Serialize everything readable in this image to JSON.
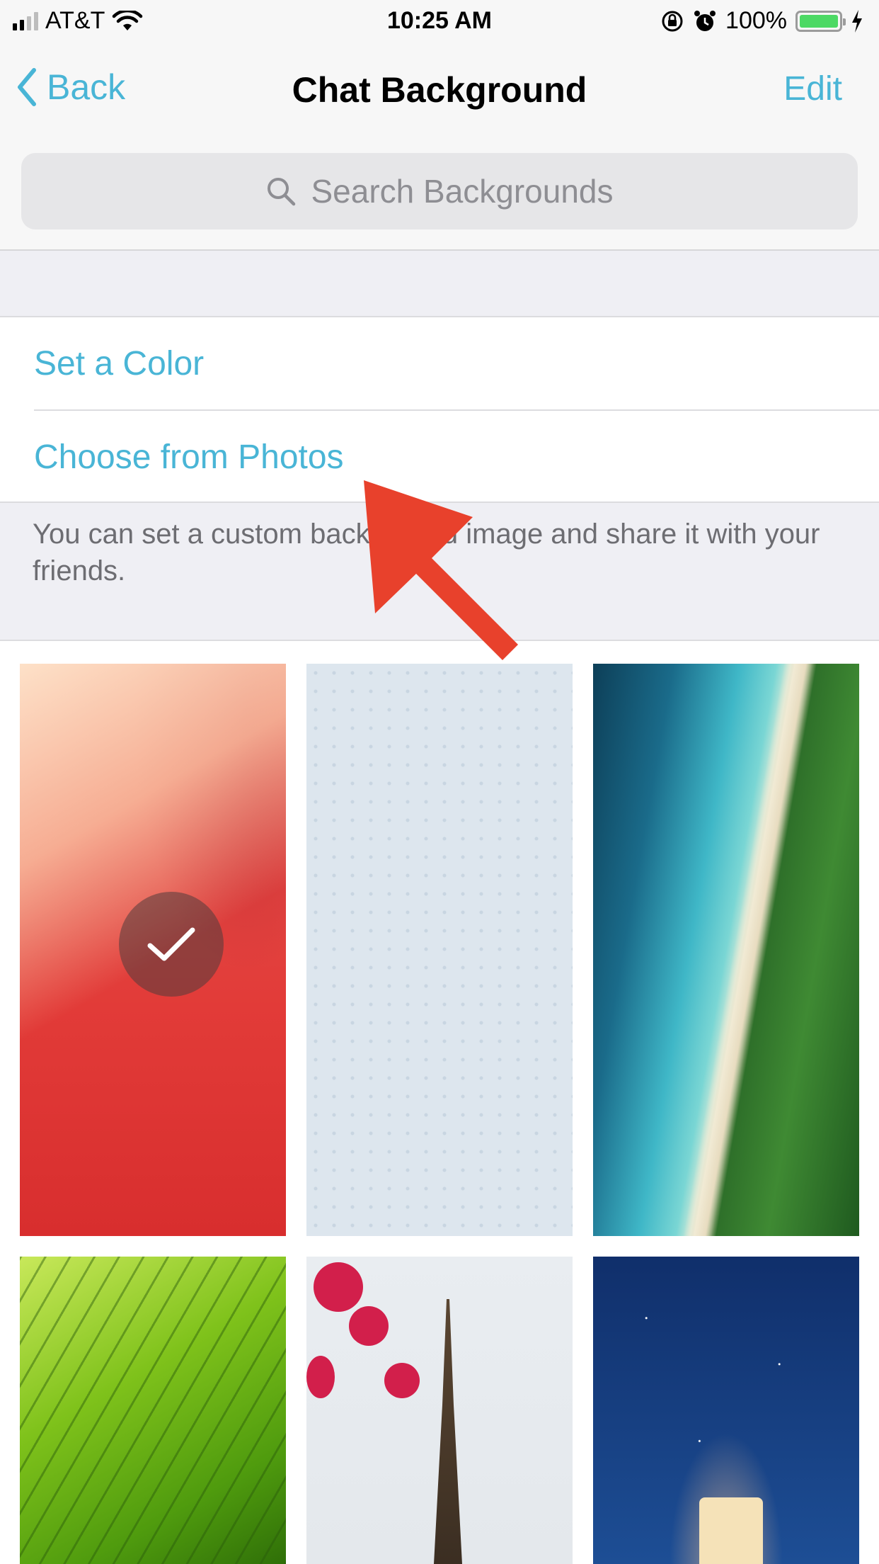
{
  "status_bar": {
    "carrier": "AT&T",
    "time": "10:25 AM",
    "battery": "100%",
    "signal_level": 2,
    "battery_level": 1.0
  },
  "nav": {
    "back_label": "Back",
    "title": "Chat Background",
    "edit_label": "Edit"
  },
  "search": {
    "placeholder": "Search Backgrounds"
  },
  "options": [
    {
      "label": "Set a Color"
    },
    {
      "label": "Choose from Photos"
    }
  ],
  "footer_text": "You can set a custom background image and share it with your friends.",
  "thumbnails": [
    {
      "name": "red abstract",
      "selected": true
    },
    {
      "name": "pattern"
    },
    {
      "name": "beach aerial"
    },
    {
      "name": "green leaf"
    },
    {
      "name": "eiffel tower"
    },
    {
      "name": "lighthouse night"
    }
  ],
  "colors": {
    "accent": "#49b5d6",
    "arrow": "#e8412c",
    "grouped_background": "#efeff4"
  }
}
